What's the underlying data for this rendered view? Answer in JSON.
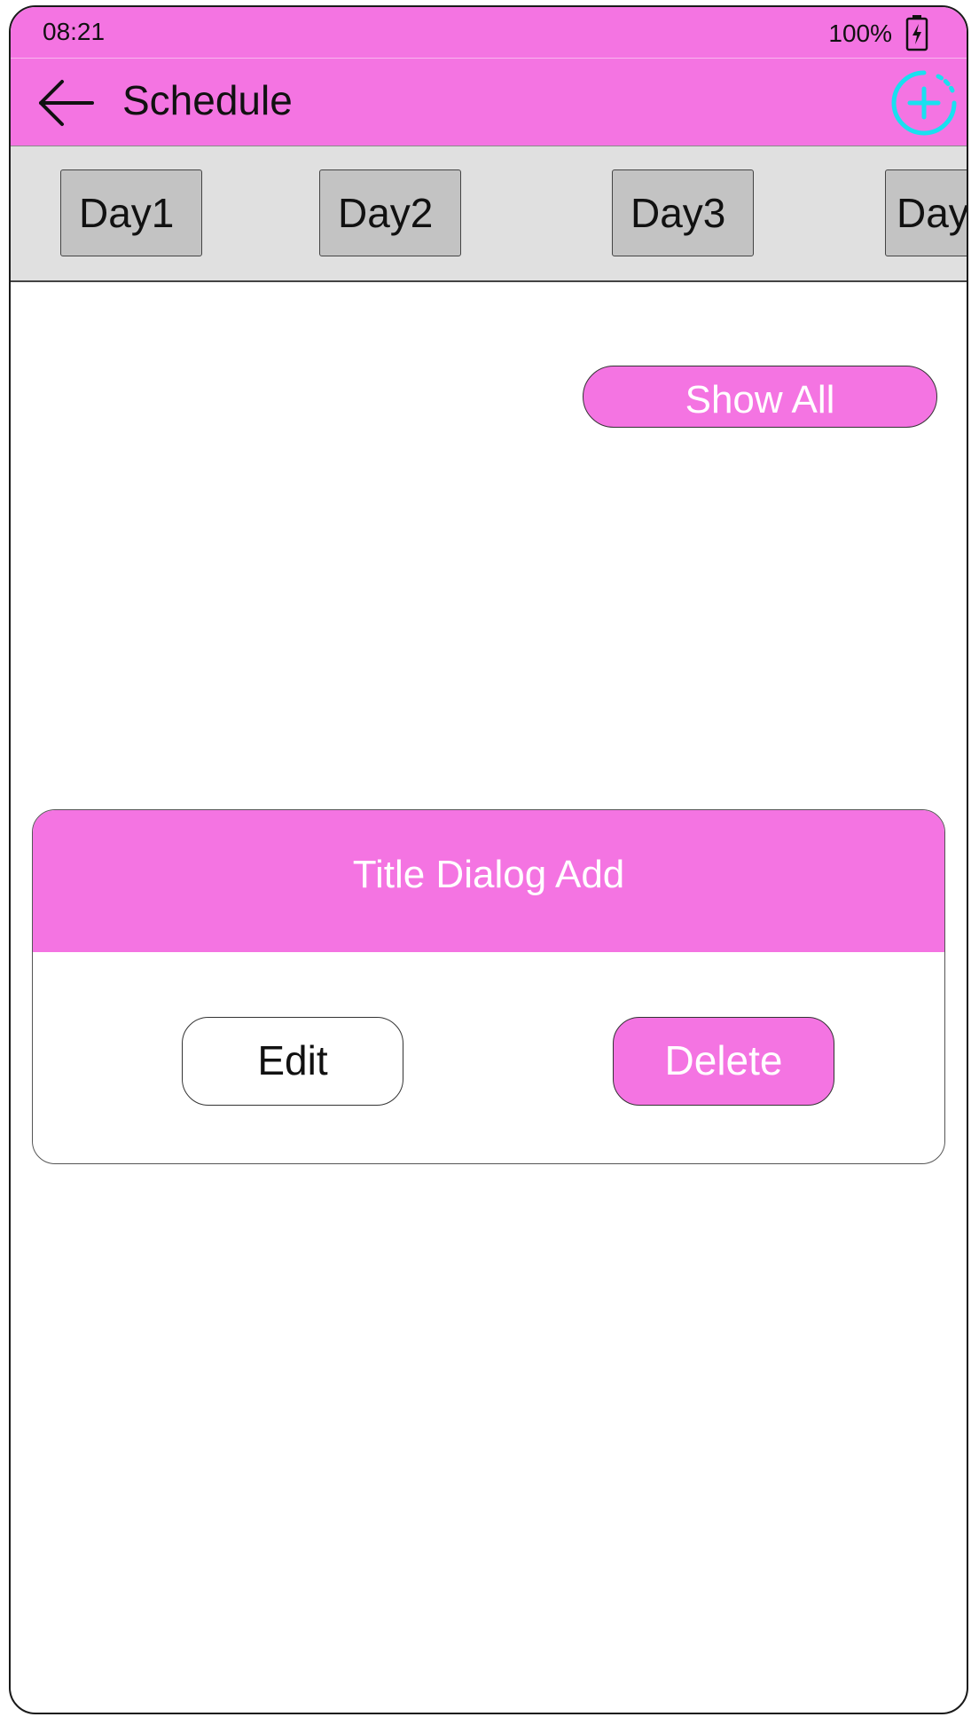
{
  "status_bar": {
    "time": "08:21",
    "battery": "100%",
    "battery_icon": "battery-charging-icon"
  },
  "app_bar": {
    "title": "Schedule",
    "back_icon": "arrow-left-icon",
    "add_icon": "add-circle-icon"
  },
  "day_tabs": [
    "Day1",
    "Day2",
    "Day3",
    "Day"
  ],
  "show_all_label": "Show All",
  "dialog": {
    "title": "Title Dialog Add",
    "edit_label": "Edit",
    "delete_label": "Delete"
  },
  "colors": {
    "accent": "#f474e2",
    "tab_bg": "#c3c3c3",
    "tab_bar_bg": "#e0e0e0",
    "add_icon": "#19e0f0"
  }
}
